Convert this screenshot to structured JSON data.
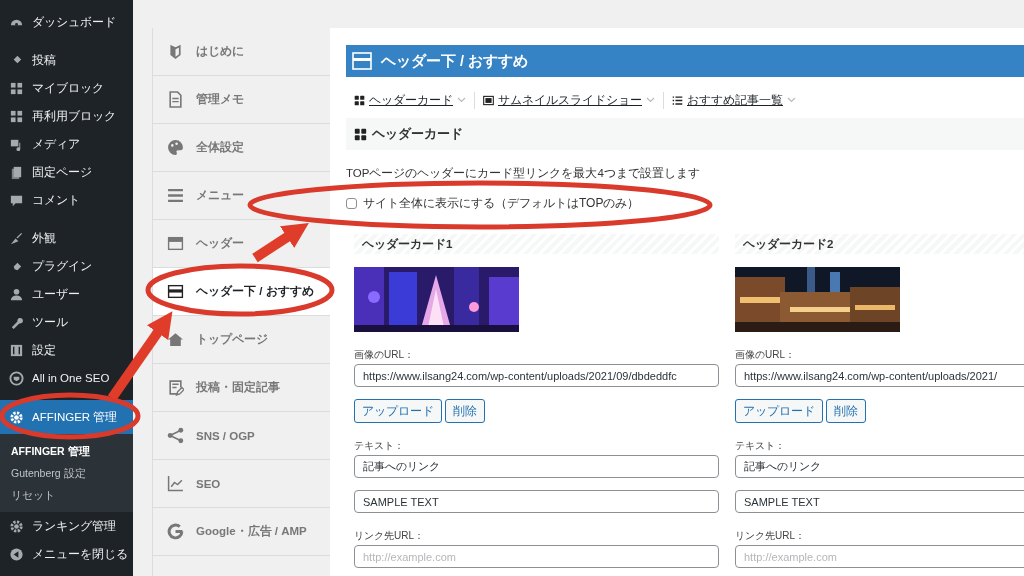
{
  "admin_menu": {
    "groups": [
      [
        {
          "label": "ダッシュボード",
          "selected": false
        }
      ],
      [
        {
          "label": "投稿",
          "selected": false
        },
        {
          "label": "マイブロック",
          "selected": false
        },
        {
          "label": "再利用ブロック",
          "selected": false
        },
        {
          "label": "メディア",
          "selected": false
        },
        {
          "label": "固定ページ",
          "selected": false
        },
        {
          "label": "コメント",
          "selected": false
        }
      ],
      [
        {
          "label": "外観",
          "selected": false
        },
        {
          "label": "プラグイン",
          "selected": false
        },
        {
          "label": "ユーザー",
          "selected": false
        },
        {
          "label": "ツール",
          "selected": false
        },
        {
          "label": "設定",
          "selected": false
        },
        {
          "label": "All in One SEO",
          "selected": false
        }
      ],
      [
        {
          "label": "AFFINGER 管理",
          "selected": true,
          "submenu": [
            {
              "label": "AFFINGER 管理",
              "selected": true
            },
            {
              "label": "Gutenberg 設定",
              "selected": false
            },
            {
              "label": "リセット",
              "selected": false
            }
          ]
        },
        {
          "label": "ランキング管理",
          "selected": false
        },
        {
          "label": "メニューを閉じる",
          "selected": false
        }
      ]
    ]
  },
  "settings_nav": {
    "items": [
      {
        "label": "はじめに",
        "selected": false
      },
      {
        "label": "管理メモ",
        "selected": false
      },
      {
        "label": "全体設定",
        "selected": false
      },
      {
        "label": "メニュー",
        "selected": false
      },
      {
        "label": "ヘッダー",
        "selected": false
      },
      {
        "label": "ヘッダー下 / おすすめ",
        "selected": true
      },
      {
        "label": "トップページ",
        "selected": false
      },
      {
        "label": "投稿・固定記事",
        "selected": false
      },
      {
        "label": "SNS / OGP",
        "selected": false
      },
      {
        "label": "SEO",
        "selected": false
      },
      {
        "label": "Google・広告 / AMP",
        "selected": false
      }
    ]
  },
  "panel": {
    "title": "ヘッダー下 / おすすめ",
    "tabs": [
      {
        "label": "ヘッダーカード"
      },
      {
        "label": "サムネイルスライドショー"
      },
      {
        "label": "おすすめ記事一覧"
      }
    ],
    "section_title": "ヘッダーカード",
    "description": "TOPページのヘッダーにカード型リンクを最大4つまで設置します",
    "checkbox": {
      "label": "サイト全体に表示にする（デフォルトはTOPのみ）",
      "checked": false
    },
    "cards": [
      {
        "title": "ヘッダーカード1",
        "image_label": "画像のURL：",
        "image_url": "https://www.ilsang24.com/wp-content/uploads/2021/09/dbdeddfc",
        "buttons": [
          "アップロード",
          "削除"
        ],
        "text_label": "テキスト：",
        "text_value": "記事へのリンク",
        "subtext_value": "SAMPLE TEXT",
        "link_label": "リンク先URL：",
        "link_placeholder": "http://example.com"
      },
      {
        "title": "ヘッダーカード2",
        "image_label": "画像のURL：",
        "image_url": "https://www.ilsang24.com/wp-content/uploads/2021/",
        "buttons": [
          "アップロード",
          "削除"
        ],
        "text_label": "テキスト：",
        "text_value": "記事へのリンク",
        "subtext_value": "SAMPLE TEXT",
        "link_label": "リンク先URL：",
        "link_placeholder": "http://example.com"
      }
    ]
  }
}
